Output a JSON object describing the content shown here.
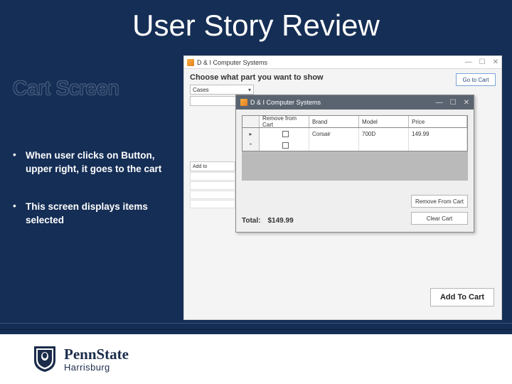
{
  "slide": {
    "title": "User Story Review",
    "section": "Cart Screen",
    "bullets": [
      "When user clicks on Button, upper right, it goes to the cart",
      "This screen displays items selected"
    ]
  },
  "app": {
    "outerWindowTitle": "D & I Computer Systems",
    "chooserLabel": "Choose what part you want to show",
    "dropdown1": "Cases",
    "dropdown2": "",
    "goToCart": "Go to Cart",
    "addToCart": "Add To Cart",
    "bgSideHeader": "Add to"
  },
  "cart": {
    "title": "D & I Computer Systems",
    "columns": {
      "remove": "Remove from Cart",
      "brand": "Brand",
      "model": "Model",
      "price": "Price"
    },
    "rows": [
      {
        "brand": "Corsair",
        "model": "700D",
        "price": "149.99"
      },
      {
        "brand": "",
        "model": "",
        "price": ""
      }
    ],
    "totalLabel": "Total:",
    "totalValue": "$149.99",
    "removeBtn": "Remove From Cart",
    "clearBtn": "Clear Cart"
  },
  "footer": {
    "uni1": "PennState",
    "uni2": "Harrisburg"
  }
}
